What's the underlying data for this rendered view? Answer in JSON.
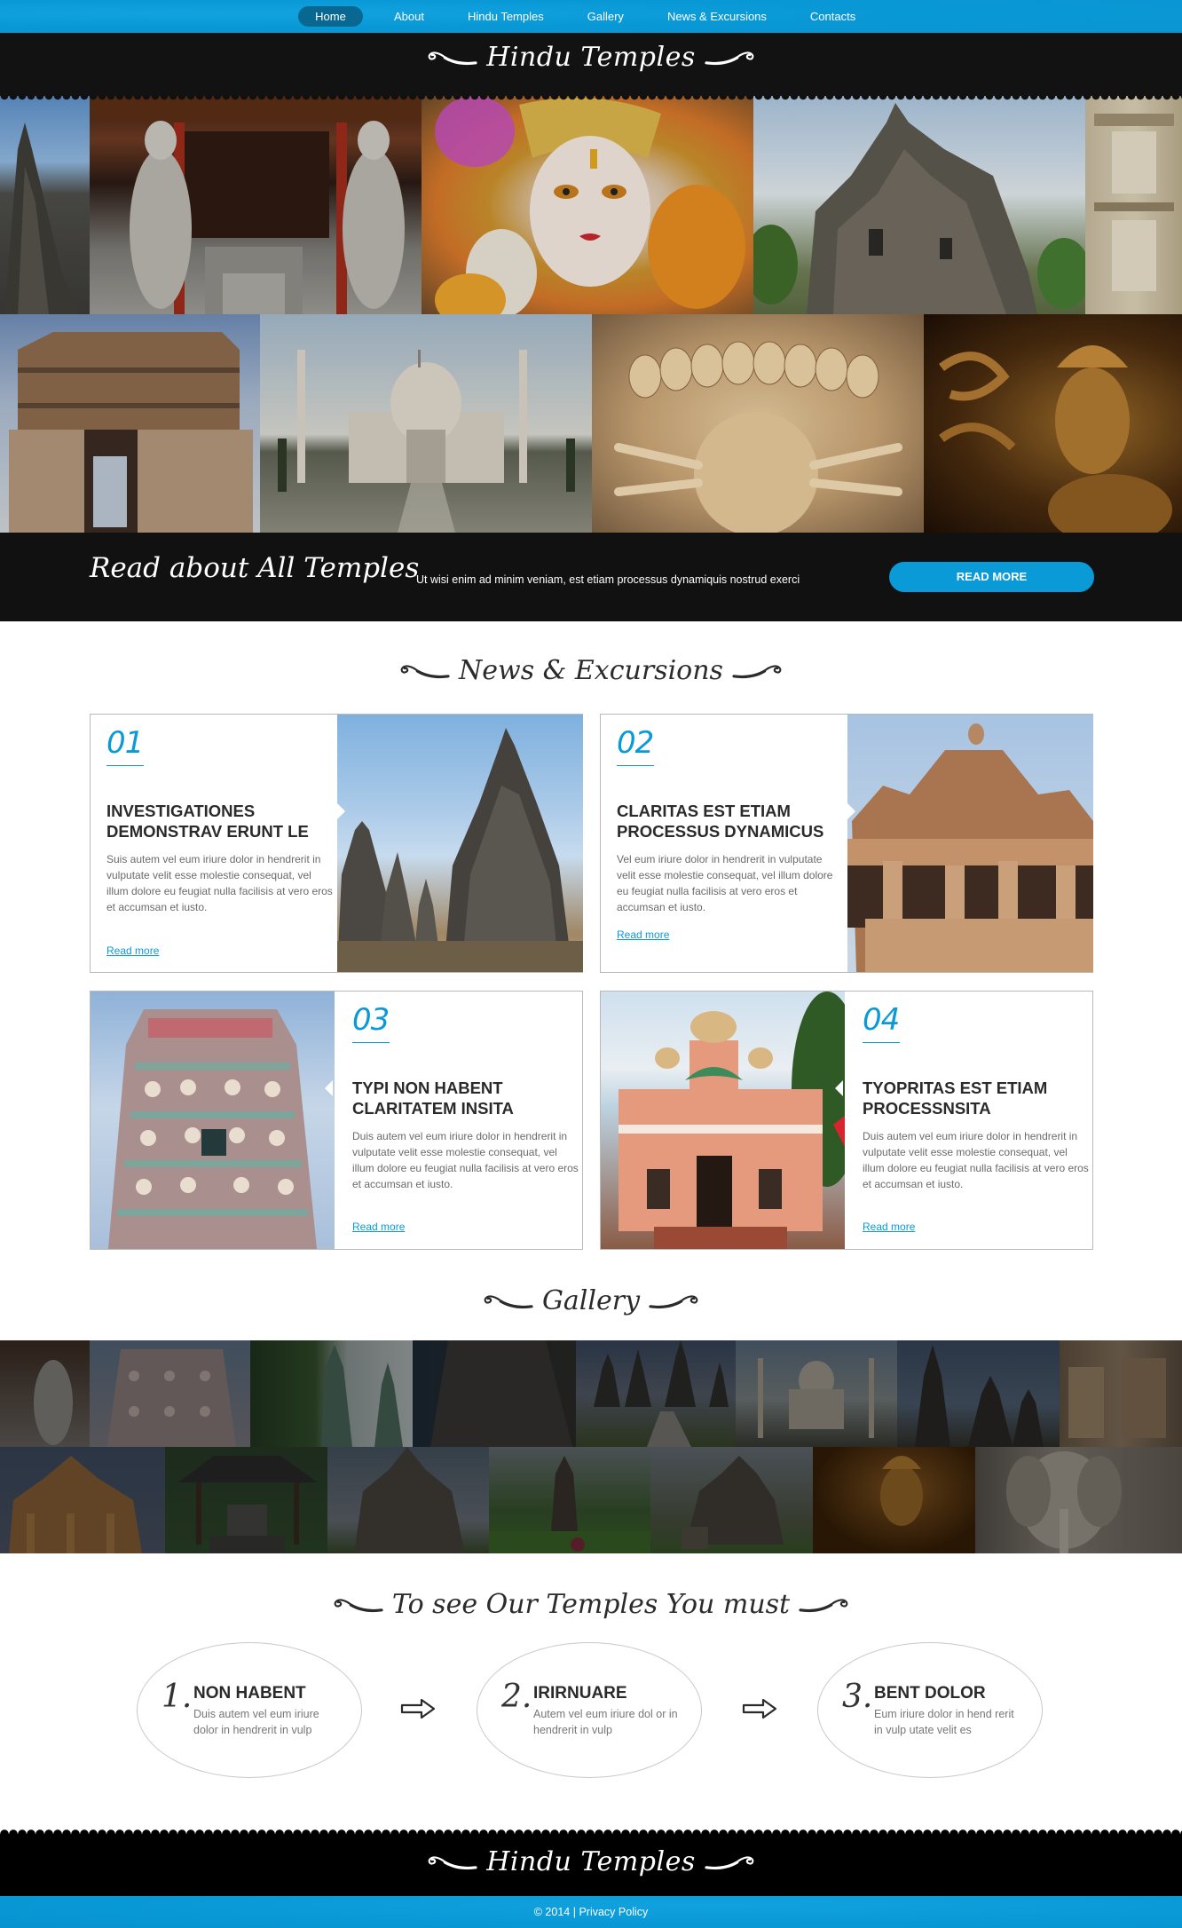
{
  "nav": {
    "items": [
      {
        "label": "Home",
        "active": true
      },
      {
        "label": "About"
      },
      {
        "label": "Hindu Temples"
      },
      {
        "label": "Gallery"
      },
      {
        "label": "News & Excursions"
      },
      {
        "label": "Contacts"
      }
    ]
  },
  "header": {
    "logo": "Hindu Temples"
  },
  "hero": {
    "tiles_row1": [
      "temple-spire",
      "balinese-guardian-statues",
      "krishna-idol",
      "stone-temple-ruins",
      "carved-temple-facade"
    ],
    "tiles_row2": [
      "hampi-gopuram",
      "taj-mahal",
      "ravana-statue",
      "golden-shiva-statue"
    ]
  },
  "cta": {
    "title": "Read about All Temples",
    "text": "Ut wisi enim ad minim veniam, est etiam processus dynamiquis nostrud exerci",
    "button": "READ MORE"
  },
  "news": {
    "title": "News & Excursions",
    "cards": [
      {
        "number": "01",
        "title": "INVESTIGATIONES DEMONSTRAV ERUNT LE",
        "description": "Suis autem vel eum iriure dolor in hendrerit in vulputate velit esse molestie consequat, vel illum dolore eu feugiat nulla facilisis at vero eros et accumsan et iusto.",
        "link": "Read more",
        "image": "prambanan-temple"
      },
      {
        "number": "02",
        "title": "CLARITAS EST ETIAM PROCESSUS DYNAMICUS",
        "description": "Vel eum iriure dolor in hendrerit in vulputate velit esse molestie consequat, vel illum dolore eu feugiat nulla facilisis at vero eros et accumsan et iusto.",
        "link": "Read more",
        "image": "khajuraho-pavilion"
      },
      {
        "number": "03",
        "title": "TYPI NON HABENT CLARITATEM INSITA",
        "description": "Duis autem vel eum iriure dolor in hendrerit in vulputate velit esse molestie consequat, vel illum dolore eu feugiat nulla facilisis at vero eros et accumsan et iusto.",
        "link": "Read more",
        "image": "gopuram-tower"
      },
      {
        "number": "04",
        "title": "TYOPRITAS EST ETIAM PROCESSNSITA",
        "description": "Duis autem vel eum iriure dolor in hendrerit in vulputate velit esse molestie consequat, vel illum dolore eu feugiat nulla facilisis at vero eros et accumsan et iusto.",
        "link": "Read more",
        "image": "goan-temple"
      }
    ]
  },
  "gallery": {
    "title": "Gallery"
  },
  "steps": {
    "title": "To see Our Temples You must",
    "items": [
      {
        "number": "1.",
        "title": "NON HABENT",
        "description": "Duis autem vel eum iriure dolor in hendrerit in vulp"
      },
      {
        "number": "2.",
        "title": "IRIRNUARE",
        "description": "Autem vel eum iriure dol or in hendrerit in vulp"
      },
      {
        "number": "3.",
        "title": "BENT DOLOR",
        "description": "Eum iriure dolor in hend rerit in vulp utate velit es"
      }
    ]
  },
  "footer": {
    "logo": "Hindu Temples",
    "copyright": "© 2014",
    "separator": "|",
    "privacy": "Privacy Policy"
  },
  "colors": {
    "accent": "#0a9ad7",
    "nav_active": "#086891",
    "dark": "#121212"
  }
}
